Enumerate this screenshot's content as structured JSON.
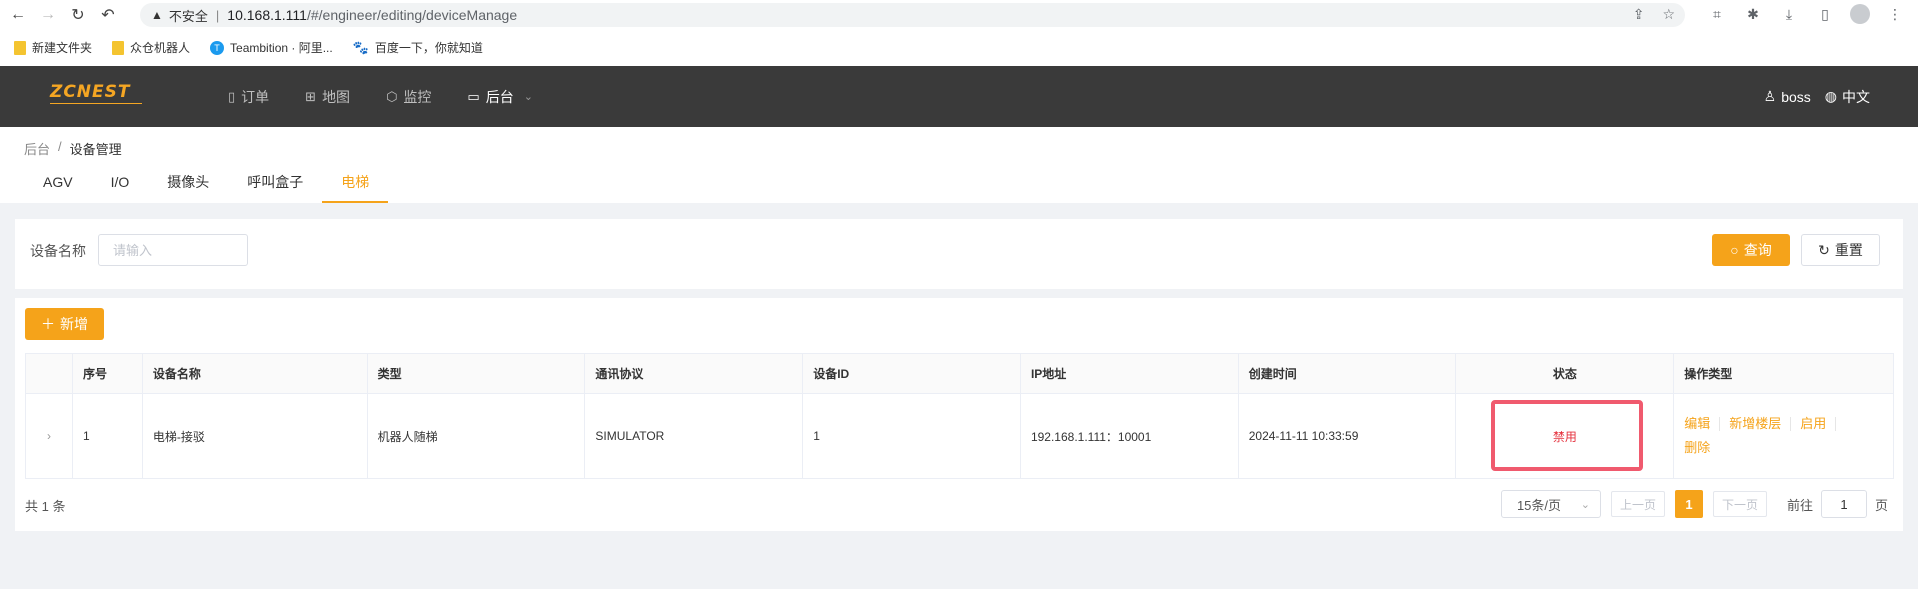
{
  "browser": {
    "insecure_label": "不安全",
    "url_host": "10.168.1.111",
    "url_path": "/#/engineer/editing/deviceManage",
    "bookmarks": [
      {
        "label": "新建文件夹",
        "icon": "folder-icon"
      },
      {
        "label": "众仓机器人",
        "icon": "folder-icon"
      },
      {
        "label": "Teambition · 阿里...",
        "icon": "teambition-icon"
      },
      {
        "label": "百度一下，你就知道",
        "icon": "baidu-icon"
      }
    ]
  },
  "header": {
    "logo_text": "ZCNEST",
    "nav": [
      {
        "label": "订单",
        "icon": "document-icon"
      },
      {
        "label": "地图",
        "icon": "map-icon"
      },
      {
        "label": "监控",
        "icon": "cube-icon"
      },
      {
        "label": "后台",
        "icon": "monitor-icon"
      }
    ],
    "user": "boss",
    "language": "中文"
  },
  "breadcrumb": {
    "root": "后台",
    "separator": "/",
    "current": "设备管理"
  },
  "tabs": [
    "AGV",
    "I/O",
    "摄像头",
    "呼叫盒子",
    "电梯"
  ],
  "active_tab_index": 4,
  "search": {
    "label": "设备名称",
    "placeholder": "请输入",
    "value": "",
    "query_label": "查询",
    "reset_label": "重置"
  },
  "toolbar": {
    "add_label": "新增"
  },
  "table": {
    "columns": [
      "序号",
      "设备名称",
      "类型",
      "通讯协议",
      "设备ID",
      "IP地址",
      "创建时间",
      "状态",
      "操作类型"
    ],
    "rows": [
      {
        "index": "1",
        "name": "电梯-接驳",
        "type": "机器人随梯",
        "protocol": "SIMULATOR",
        "device_id": "1",
        "ip": "192.168.1.111：10001",
        "created": "2024-11-11 10:33:59",
        "status": "禁用",
        "actions": [
          "编辑",
          "新增楼层",
          "启用",
          "删除"
        ]
      }
    ]
  },
  "pagination": {
    "total": "共 1 条",
    "page_size": "15条/页",
    "prev": "上一页",
    "next": "下一页",
    "current_page": "1",
    "goto_prefix": "前往",
    "goto_value": "1",
    "goto_suffix": "页"
  },
  "colors": {
    "accent": "#f5a31a",
    "header_bg": "#3a3a3a",
    "status_disabled": "#e5323e",
    "highlight": "#f05a6e"
  }
}
